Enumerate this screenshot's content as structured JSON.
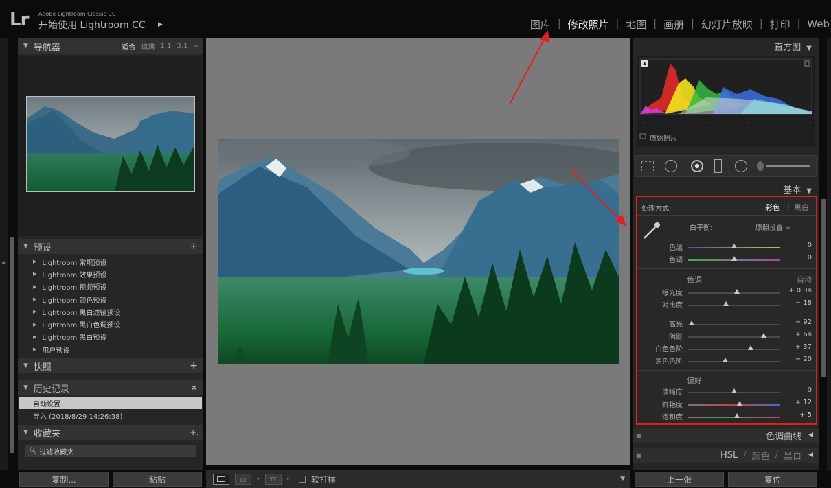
{
  "app": {
    "logo": "Lr",
    "brand_small": "Adobe Lightroom Classic CC",
    "brand_main": "开始使用 Lightroom CC",
    "brand_caret": "▶"
  },
  "modules": [
    {
      "label": "图库",
      "active": false
    },
    {
      "label": "修改照片",
      "active": true
    },
    {
      "label": "地图",
      "active": false
    },
    {
      "label": "画册",
      "active": false
    },
    {
      "label": "幻灯片放映",
      "active": false
    },
    {
      "label": "打印",
      "active": false
    },
    {
      "label": "Web",
      "active": false
    }
  ],
  "navigator": {
    "title": "导航器",
    "options": [
      "适合",
      "填满",
      "1:1",
      "3:1"
    ]
  },
  "presets": {
    "title": "预设",
    "add": "+",
    "items": [
      "Lightroom 常规预设",
      "Lightroom 效果预设",
      "Lightroom 视频预设",
      "Lightroom 颜色预设",
      "Lightroom 黑白滤镜预设",
      "Lightroom 黑白色调预设",
      "Lightroom 黑白预设",
      "用户预设"
    ]
  },
  "snapshots": {
    "title": "快照",
    "add": "+"
  },
  "history": {
    "title": "历史记录",
    "close": "×",
    "items": [
      "自动设置",
      "导入 (2018/8/29 14:26:38)"
    ]
  },
  "collections": {
    "title": "收藏夹",
    "add": "+.",
    "filter": "过滤收藏夹"
  },
  "left_buttons": {
    "copy": "复制...",
    "paste": "粘贴"
  },
  "toolbar": {
    "soft_proof": "软打样",
    "yy": "YY"
  },
  "histogram": {
    "title": "直方图",
    "original_photo": "原始照片"
  },
  "basic": {
    "title": "基本",
    "treatment_label": "处理方式:",
    "treatment_color": "彩色",
    "treatment_bw": "黑白",
    "wb_label": "白平衡:",
    "wb_value": "原照设置 ÷",
    "tone_title": "色调",
    "auto": "自动",
    "presence_title": "偏好",
    "sliders": [
      {
        "label": "色温",
        "value": "0",
        "pos": 0.5
      },
      {
        "label": "色调",
        "value": "0",
        "pos": 0.5
      },
      {
        "label": "曝光度",
        "value": "+ 0.34",
        "pos": 0.53
      },
      {
        "label": "对比度",
        "value": "− 18",
        "pos": 0.41
      },
      {
        "label": "高光",
        "value": "− 92",
        "pos": 0.04
      },
      {
        "label": "阴影",
        "value": "+ 64",
        "pos": 0.82
      },
      {
        "label": "白色色阶",
        "value": "+ 37",
        "pos": 0.68
      },
      {
        "label": "黑色色阶",
        "value": "− 20",
        "pos": 0.4
      },
      {
        "label": "清晰度",
        "value": "0",
        "pos": 0.5
      },
      {
        "label": "鲜艳度",
        "value": "+ 12",
        "pos": 0.56
      },
      {
        "label": "饱和度",
        "value": "+ 5",
        "pos": 0.53
      }
    ]
  },
  "tone_curve": {
    "title": "色调曲线"
  },
  "hsl": {
    "hsl": "HSL",
    "color": "颜色",
    "bw": "黑白",
    "sep": "/"
  },
  "right_buttons": {
    "prev": "上一张",
    "reset": "复位"
  },
  "colors": {
    "accent_red": "#e02020",
    "panel_bg": "#262626",
    "center_bg": "#7a7a7a"
  }
}
